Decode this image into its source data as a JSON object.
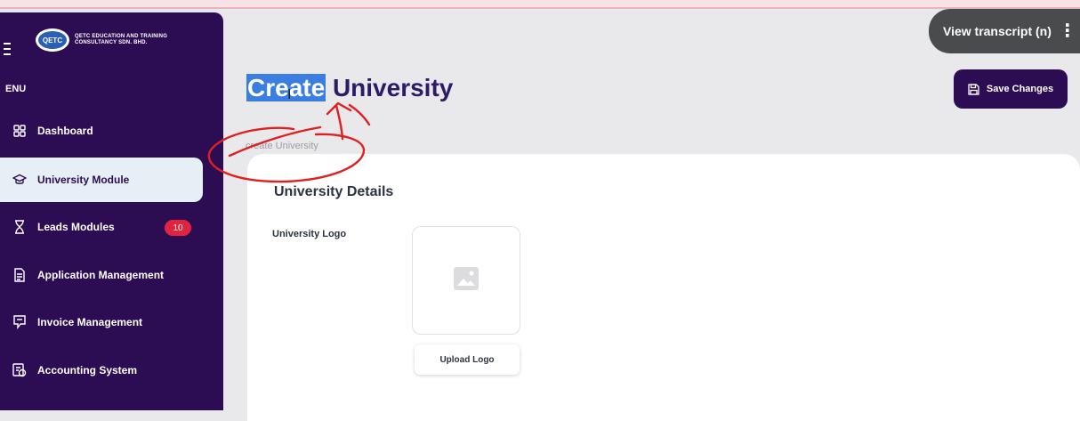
{
  "overlay": {
    "transcript_label": "View transcript (n)"
  },
  "sidebar": {
    "logo_initials": "QETC",
    "logo_line1": "QETC EDUCATION AND TRAINING",
    "logo_line2": "CONSULTANCY SDN. BHD.",
    "menu_label": "ENU",
    "items": [
      {
        "label": "Dashboard",
        "icon": "grid-icon"
      },
      {
        "label": "University Module",
        "icon": "graduation-cap-icon",
        "active": true
      },
      {
        "label": "Leads Modules",
        "icon": "hourglass-icon",
        "badge": "10"
      },
      {
        "label": "Application Management",
        "icon": "document-icon"
      },
      {
        "label": "Invoice Management",
        "icon": "invoice-icon"
      },
      {
        "label": "Accounting System",
        "icon": "accounting-icon"
      }
    ]
  },
  "header": {
    "title_selected": "Create",
    "title_rest": " University",
    "breadcrumb": "create University",
    "save_label": "Save Changes"
  },
  "card": {
    "title": "University Details",
    "logo_label": "University Logo",
    "upload_label": "Upload Logo"
  },
  "colors": {
    "sidebar_bg": "#2c0d53",
    "active_item_bg": "#e6eef6",
    "badge": "#e0243f",
    "title": "#2d1b67",
    "annotation": "#e0201f"
  }
}
